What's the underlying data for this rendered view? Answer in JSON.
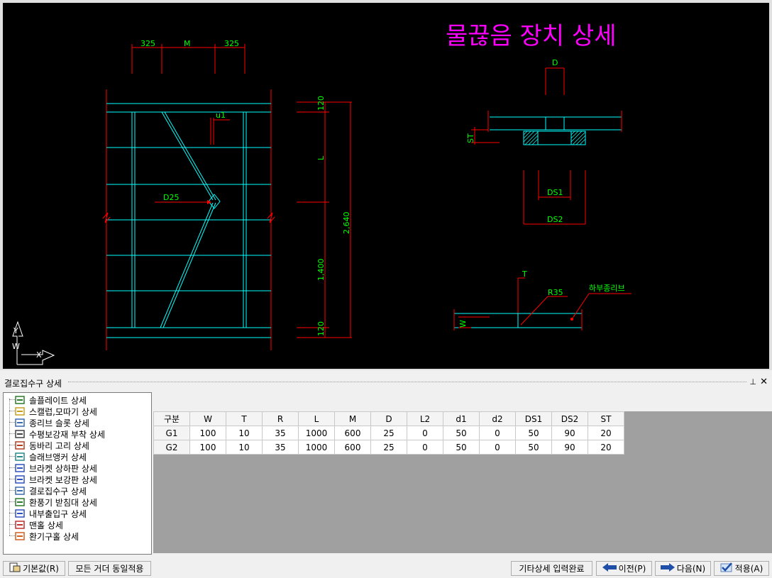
{
  "drawing": {
    "title": "물끊음 장치 상세",
    "dims_top": [
      "325",
      "M",
      "325"
    ],
    "u1": "u1",
    "d25": "D25",
    "dim_120_top": "120",
    "dim_L": "L",
    "dim_2640": "2,640",
    "dim_1400": "1,400",
    "dim_120_bot": "120",
    "detail_D": "D",
    "detail_ST": "ST",
    "detail_DS1": "DS1",
    "detail_DS2": "DS2",
    "detail_T": "T",
    "detail_R35": "R35",
    "detail_W": "W",
    "detail_lower_rib": "하부종리브",
    "axis_y": "Y",
    "axis_w": "W",
    "axis_x": "X"
  },
  "panel": {
    "title": "결로집수구 상세",
    "pin": "ᵖ",
    "close": "✕"
  },
  "tree": {
    "items": [
      {
        "label": "솔플레이트 상세",
        "icon": "sole-plate-icon"
      },
      {
        "label": "스캘럽,모따기 상세",
        "icon": "scallop-icon"
      },
      {
        "label": "종리브 슬롯 상세",
        "icon": "rib-slot-icon"
      },
      {
        "label": "수평보강재 부착 상세",
        "icon": "stiffener-icon"
      },
      {
        "label": "동바리 고리 상세",
        "icon": "shore-ring-icon"
      },
      {
        "label": "슬래브앵커 상세",
        "icon": "slab-anchor-icon"
      },
      {
        "label": "브라켓 상하판 상세",
        "icon": "bracket-plate-icon"
      },
      {
        "label": "브라켓 보강판 상세",
        "icon": "bracket-stiffener-icon"
      },
      {
        "label": "결로집수구 상세",
        "icon": "drain-icon"
      },
      {
        "label": "환풍기 받침대 상세",
        "icon": "fan-support-icon"
      },
      {
        "label": "내부출입구 상세",
        "icon": "inner-door-icon"
      },
      {
        "label": "맨홀 상세",
        "icon": "manhole-icon"
      },
      {
        "label": "환기구홀 상세",
        "icon": "vent-hole-icon"
      }
    ]
  },
  "grid": {
    "headers": [
      "구분",
      "W",
      "T",
      "R",
      "L",
      "M",
      "D",
      "L2",
      "d1",
      "d2",
      "DS1",
      "DS2",
      "ST"
    ],
    "rows": [
      [
        "G1",
        "100",
        "10",
        "35",
        "1000",
        "600",
        "25",
        "0",
        "50",
        "0",
        "50",
        "90",
        "20"
      ],
      [
        "G2",
        "100",
        "10",
        "35",
        "1000",
        "600",
        "25",
        "0",
        "50",
        "0",
        "50",
        "90",
        "20"
      ]
    ]
  },
  "buttons": {
    "default": "기본값(R)",
    "apply_all": "모든 거더 동일적용",
    "other_done": "기타상세 입력완료",
    "prev": "이전(P)",
    "next": "다음(N)",
    "apply": "적용(A)"
  },
  "colors": {
    "cad_bg": "#000000",
    "cad_red": "#ff0000",
    "cad_cyan": "#00ffff",
    "cad_green": "#00ff00",
    "cad_magenta": "#ff00ff"
  }
}
